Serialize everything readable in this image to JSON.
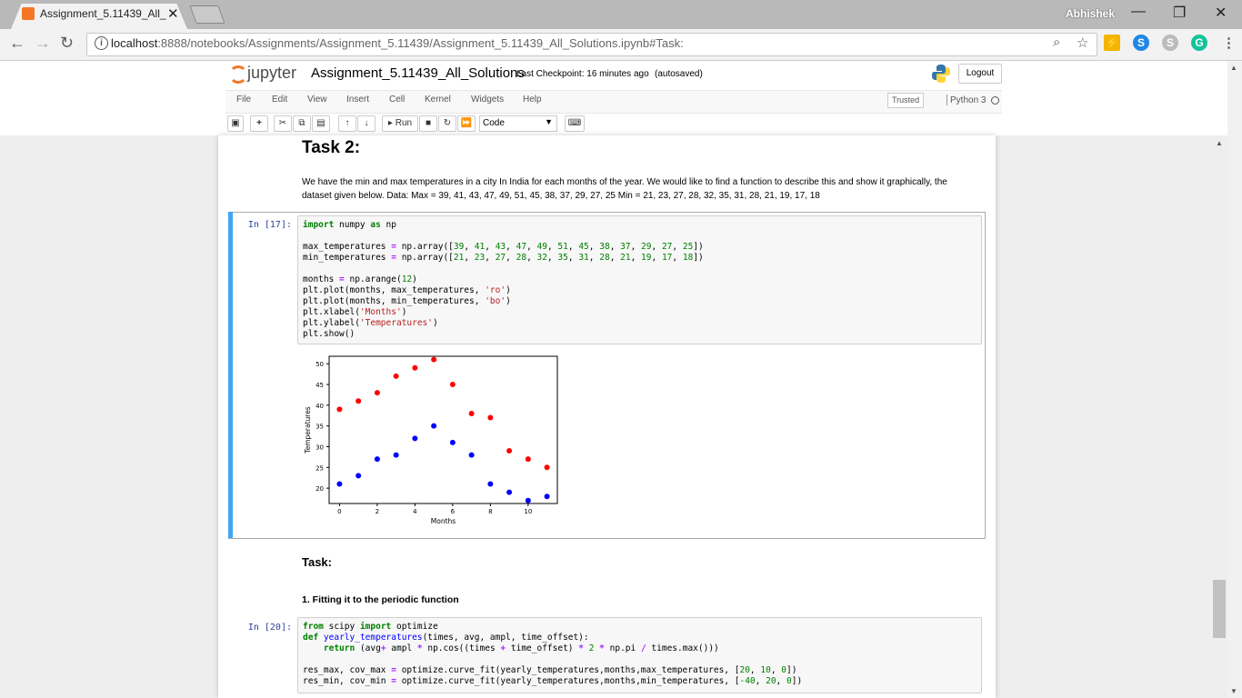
{
  "browser": {
    "tab_title": "Assignment_5.11439_All_",
    "user": "Abhishek",
    "url_host": "localhost",
    "url_rest": ":8888/notebooks/Assignments/Assignment_5.11439/Assignment_5.11439_All_Solutions.ipynb#Task:"
  },
  "jupyter": {
    "logo_text": "jupyter",
    "notebook_name": "Assignment_5.11439_All_Solutions",
    "checkpoint": "Last Checkpoint: 16 minutes ago",
    "autosaved": "(autosaved)",
    "logout": "Logout",
    "menu": [
      "File",
      "Edit",
      "View",
      "Insert",
      "Cell",
      "Kernel",
      "Widgets",
      "Help"
    ],
    "trusted": "Trusted",
    "kernel": "Python 3",
    "run_label": "Run",
    "cell_type": "Code"
  },
  "cells": {
    "task2_heading": "Task 2:",
    "task2_text": "We have the min and max temperatures in a city In India for each months of the year. We would like to find a function to describe this and show it graphically, the dataset given below. Data: Max = 39, 41, 43, 47, 49, 51, 45, 38, 37, 29, 27, 25 Min = 21, 23, 27, 28, 32, 35, 31, 28, 21, 19, 17, 18",
    "prompt17": "In [17]:",
    "prompt20": "In [20]:",
    "task_heading": "Task:",
    "fitting_heading": "1. Fitting it to the periodic function"
  },
  "chart_data": {
    "type": "scatter",
    "xlabel": "Months",
    "ylabel": "Temperatures",
    "xlim": [
      -0.55,
      11.55
    ],
    "ylim": [
      16.3,
      51.8
    ],
    "xticks": [
      0,
      2,
      4,
      6,
      8,
      10
    ],
    "yticks": [
      20,
      25,
      30,
      35,
      40,
      45,
      50
    ],
    "x": [
      0,
      1,
      2,
      3,
      4,
      5,
      6,
      7,
      8,
      9,
      10,
      11
    ],
    "series": [
      {
        "values": [
          39,
          41,
          43,
          47,
          49,
          51,
          45,
          38,
          37,
          29,
          27,
          25
        ],
        "color": "#ff0000"
      },
      {
        "values": [
          21,
          23,
          27,
          28,
          32,
          35,
          31,
          28,
          21,
          19,
          17,
          18
        ],
        "color": "#0000ff"
      }
    ]
  }
}
